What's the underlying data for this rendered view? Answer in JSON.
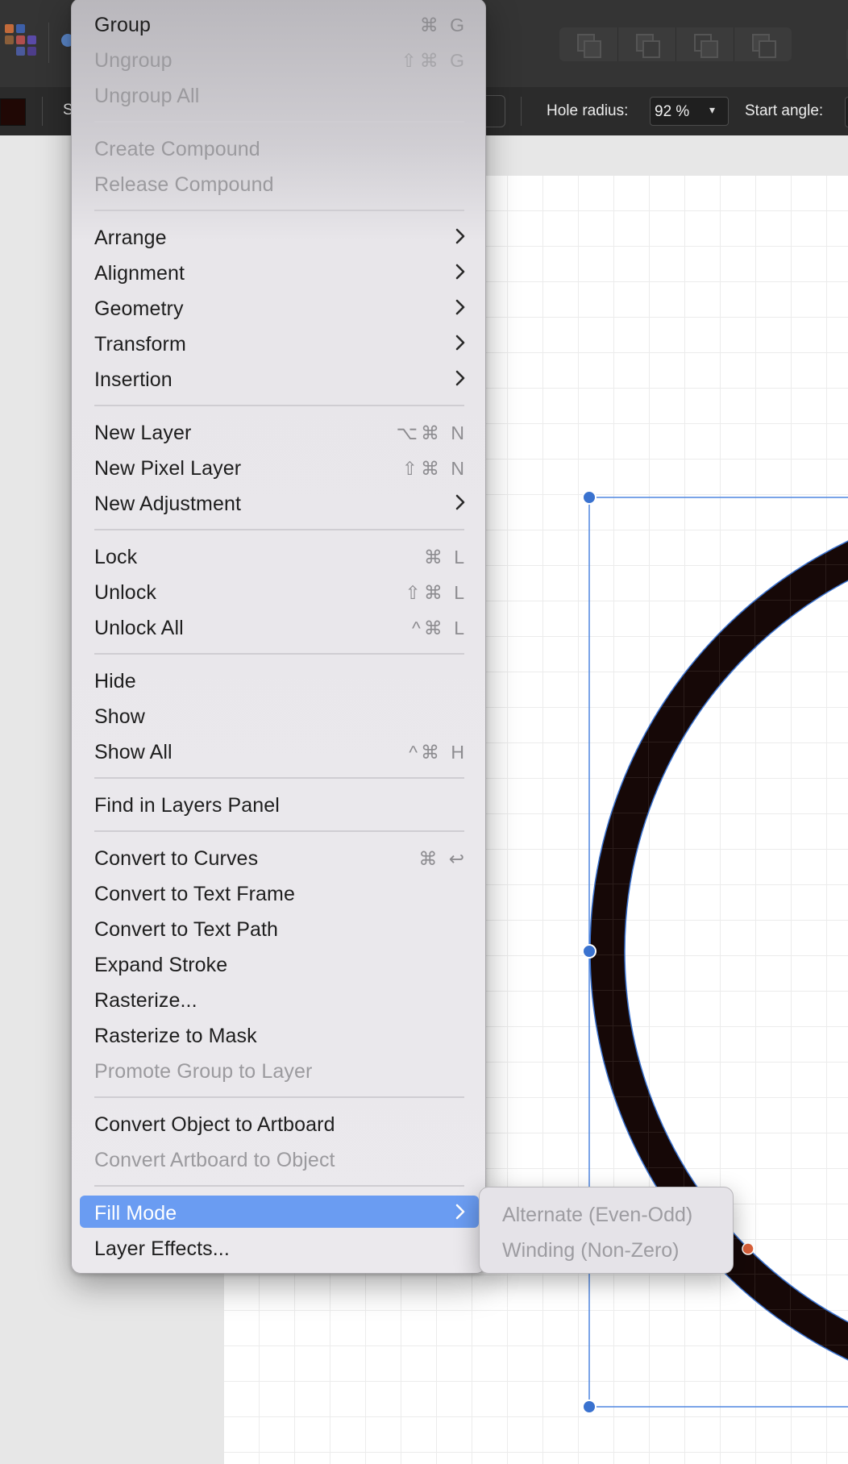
{
  "toolbar": {
    "partial_label": "S",
    "hole_radius_label": "Hole radius:",
    "hole_radius_value": "92 %",
    "start_angle_label": "Start angle:",
    "fill_color": "#200805"
  },
  "context_menu": {
    "items": {
      "group": {
        "label": "Group",
        "shortcut": "⌘ G"
      },
      "ungroup": {
        "label": "Ungroup",
        "shortcut": "⇧⌘ G"
      },
      "ungroup_all": {
        "label": "Ungroup All"
      },
      "create_compound": {
        "label": "Create Compound"
      },
      "release_compound": {
        "label": "Release Compound"
      },
      "arrange": {
        "label": "Arrange"
      },
      "alignment": {
        "label": "Alignment"
      },
      "geometry": {
        "label": "Geometry"
      },
      "transform": {
        "label": "Transform"
      },
      "insertion": {
        "label": "Insertion"
      },
      "new_layer": {
        "label": "New Layer",
        "shortcut": "⌥⌘ N"
      },
      "new_pixel_layer": {
        "label": "New Pixel Layer",
        "shortcut": "⇧⌘ N"
      },
      "new_adjustment": {
        "label": "New Adjustment"
      },
      "lock": {
        "label": "Lock",
        "shortcut": "⌘ L"
      },
      "unlock": {
        "label": "Unlock",
        "shortcut": "⇧⌘ L"
      },
      "unlock_all": {
        "label": "Unlock All",
        "shortcut": "^⌘ L"
      },
      "hide": {
        "label": "Hide"
      },
      "show": {
        "label": "Show"
      },
      "show_all": {
        "label": "Show All",
        "shortcut": "^⌘ H"
      },
      "find_in_layers": {
        "label": "Find in Layers Panel"
      },
      "convert_to_curves": {
        "label": "Convert to Curves",
        "shortcut": "⌘ ↩"
      },
      "convert_to_text_frame": {
        "label": "Convert to Text Frame"
      },
      "convert_to_text_path": {
        "label": "Convert to Text Path"
      },
      "expand_stroke": {
        "label": "Expand Stroke"
      },
      "rasterize": {
        "label": "Rasterize..."
      },
      "rasterize_to_mask": {
        "label": "Rasterize to Mask"
      },
      "promote_group": {
        "label": "Promote Group to Layer"
      },
      "convert_object_to_artboard": {
        "label": "Convert Object to Artboard"
      },
      "convert_artboard_to_object": {
        "label": "Convert Artboard to Object"
      },
      "fill_mode": {
        "label": "Fill Mode"
      },
      "layer_effects": {
        "label": "Layer Effects..."
      }
    }
  },
  "submenu": {
    "alternate": {
      "label": "Alternate (Even-Odd)"
    },
    "winding": {
      "label": "Winding (Non-Zero)"
    }
  },
  "colors": {
    "accent": "#6a9cf2",
    "selection_handle": "#3a72cf",
    "ring_fill": "#160807",
    "rotation_handle": "#d9603a"
  }
}
